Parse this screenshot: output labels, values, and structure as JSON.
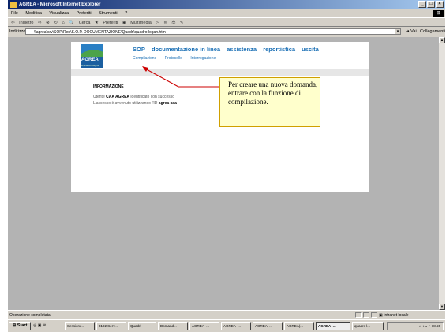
{
  "window": {
    "title": "AGREA - Microsoft Internet Explorer"
  },
  "menu": [
    "File",
    "Modifica",
    "Visualizza",
    "Preferiti",
    "Strumenti",
    "?"
  ],
  "toolbar": [
    "Indietro",
    "Cerca",
    "Preferiti",
    "Multimedia"
  ],
  "address": {
    "label": "Indirizzo",
    "value": "\\\\agrea\\srv\\SOP\\Ren\\S.O.P. DOCUMENTAZIONE\\Quadri\\quadro logan.htm",
    "go": "Vai",
    "links": "Collegamenti"
  },
  "site": {
    "logo": "AGREA",
    "logo_sub": "Emilia Romagna",
    "nav": [
      "SOP",
      "documentazione in linea",
      "assistenza",
      "reportistica",
      "uscita"
    ],
    "subnav": [
      "Compilazione",
      "Protocollo",
      "Interrogazione"
    ]
  },
  "info": {
    "title": "INFORMAZIONE",
    "line1_prefix": "Utente ",
    "line1_bold": "CAA AGREA",
    "line1_suffix": " identificato con successo",
    "line2_prefix": "L'accesso è avvenuto utilizzando l'ID ",
    "line2_bold": "agrea caa"
  },
  "callout": {
    "text": "Per creare una nuova domanda, entrare con la funzione di compilazione."
  },
  "status": {
    "text": "Operazione completata",
    "zone": "Intranet locale"
  },
  "taskbar": {
    "start": "Start",
    "buttons": [
      "Sessione...",
      "3192 Serv...",
      "Quadri",
      "Domand...",
      "AGREA -...",
      "AGREA -...",
      "AGREA -...",
      "AGREA(...",
      "AGREA -...",
      "quadro l..."
    ],
    "clock": "18.55"
  },
  "colors": {
    "accent": "#1a6fb5",
    "callout_bg": "#ffffcc",
    "callout_border": "#d0a000",
    "arrow": "#cc0000"
  }
}
